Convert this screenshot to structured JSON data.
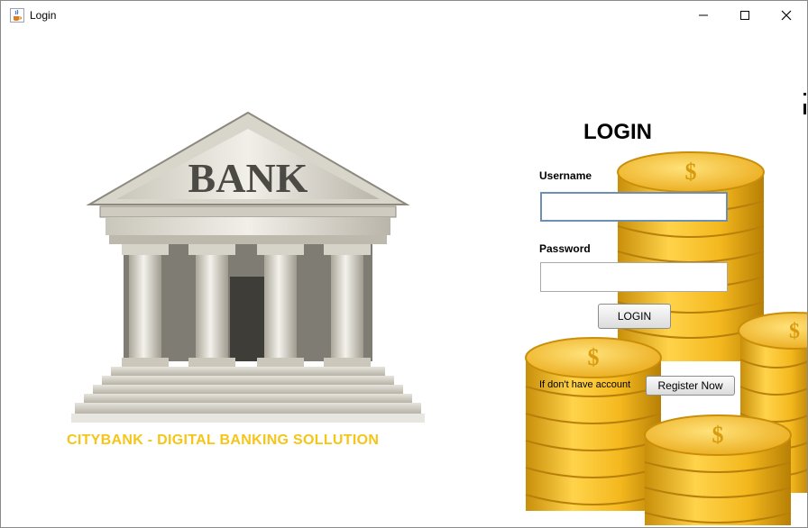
{
  "window": {
    "title": "Login",
    "icon": "java-cup-icon"
  },
  "branding": {
    "tagline": "CITYBANK - DIGITAL BANKING SOLLUTION",
    "bank_sign": "BANK",
    "tagline_color": "#f5c518"
  },
  "login": {
    "heading": "LOGIN",
    "username_label": "Username",
    "username_value": "",
    "password_label": "Password",
    "password_value": "",
    "login_button": "LOGIN",
    "no_account_text": "If don't have account",
    "register_button": "Register Now"
  }
}
